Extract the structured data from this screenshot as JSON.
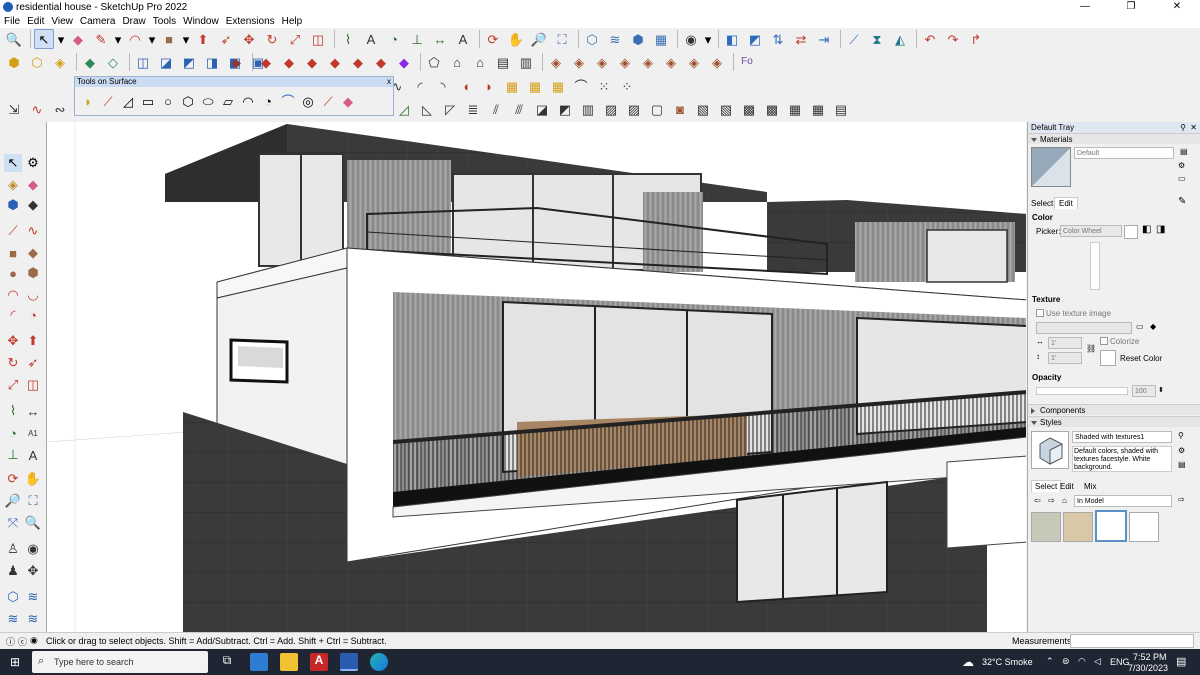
{
  "window": {
    "title": "residential house - SketchUp Pro 2022",
    "controls": [
      "—",
      "❐",
      "✕"
    ]
  },
  "menu": [
    "File",
    "Edit",
    "View",
    "Camera",
    "Draw",
    "Tools",
    "Window",
    "Extensions",
    "Help"
  ],
  "floating_toolbar": {
    "title": "Tools on Surface",
    "close": "x"
  },
  "tray": {
    "title": "Default Tray",
    "materials": {
      "header": "Materials",
      "material_name": "Default",
      "tabs": [
        "Select",
        "Edit"
      ],
      "color_label": "Color",
      "picker_label": "Picker:",
      "picker_value": "Color Wheel",
      "texture_label": "Texture",
      "use_texture": "Use texture image",
      "dim_w": "1'",
      "dim_h": "1'",
      "colorize": "Colorize",
      "reset_color": "Reset Color",
      "opacity_label": "Opacity",
      "opacity_value": "100"
    },
    "components_header": "Components",
    "styles": {
      "header": "Styles",
      "style_name": "Shaded with textures1",
      "style_desc": "Default colors, shaded with textures facestyle. White background.",
      "tabs": [
        "Select",
        "Edit",
        "Mix"
      ],
      "collection": "In Model"
    }
  },
  "status": {
    "hint": "Click or drag to select objects. Shift = Add/Subtract. Ctrl = Add. Shift + Ctrl = Subtract.",
    "measurements_label": "Measurements"
  },
  "taskbar": {
    "search_placeholder": "Type here to search",
    "weather": "32°C  Smoke",
    "language": "ENG",
    "time": "7:52 PM",
    "date": "7/30/2023"
  },
  "colors": {
    "accent": "#1a5fb4",
    "taskbar": "#1f2533",
    "tray_header": "#dfe7f2"
  }
}
